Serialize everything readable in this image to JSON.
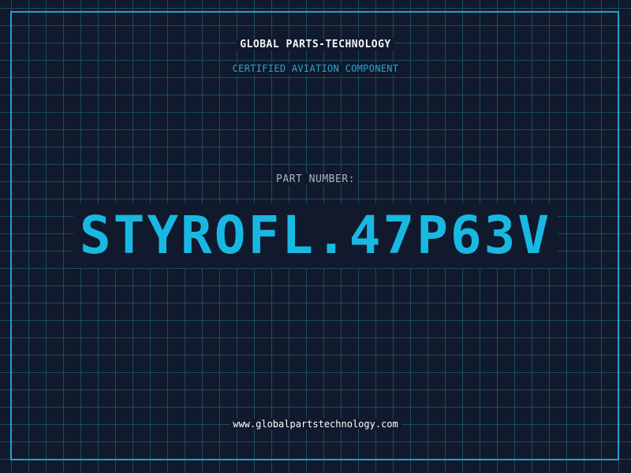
{
  "header": {
    "company": "GLOBAL PARTS-TECHNOLOGY",
    "subtitle": "CERTIFIED AVIATION COMPONENT"
  },
  "part": {
    "label": "PART NUMBER:",
    "number": "STYROFL.47P63V"
  },
  "footer": {
    "website": "www.globalpartstechnology.com"
  },
  "colors": {
    "background": "#101a2c",
    "grid": "#1d4a5e",
    "accent": "#1fa3cf",
    "part_number": "#19b8e3"
  }
}
